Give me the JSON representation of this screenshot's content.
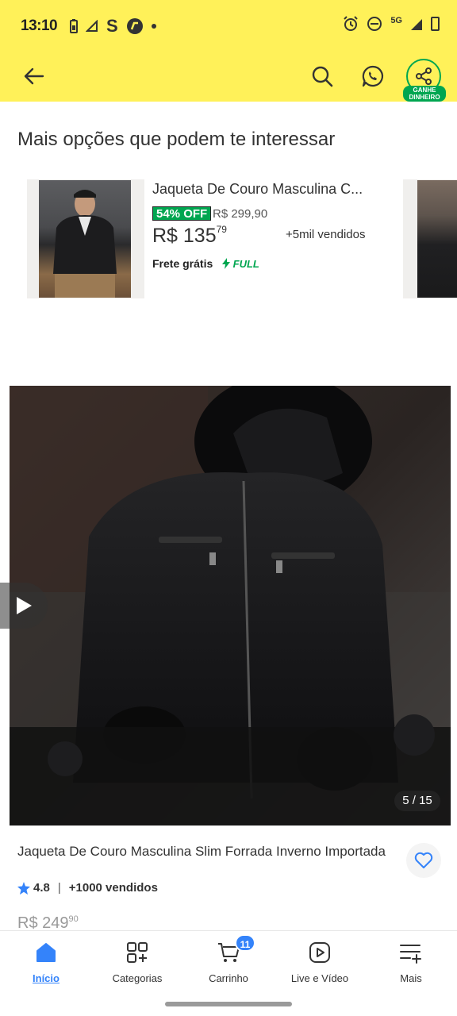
{
  "status_bar": {
    "time": "13:10",
    "left_icons": [
      "battery-saver-icon",
      "signal-a-icon",
      "s-app-icon",
      "hand-app-icon",
      "notification-dot"
    ],
    "right_icons": [
      "alarm-icon",
      "dnd-icon",
      "5g-signal-icon",
      "battery-icon"
    ],
    "network": "5G"
  },
  "app_bar": {
    "background": "#fff159",
    "share_badge_line1": "GANHE",
    "share_badge_line2": "DINHEIRO",
    "accent": "#00a650"
  },
  "recommendations": {
    "title": "Mais opções que podem te interessar",
    "items": [
      {
        "title": "Jaqueta De Couro Masculina C...",
        "discount": "54% OFF",
        "old_price": "R$ 299,90",
        "price_main": "R$ 135",
        "price_cents": "79",
        "sold": "+5mil vendidos",
        "shipping": "Frete grátis",
        "full_label": "FULL"
      }
    ]
  },
  "gallery": {
    "counter": "5 / 15"
  },
  "product": {
    "title": "Jaqueta De Couro Masculina Slim Forrada Inverno Importada",
    "rating": "4.8",
    "separator": "|",
    "sold": "+1000 vendidos",
    "price_main": "R$ 249",
    "price_cents": "90"
  },
  "bottom_nav": {
    "items": [
      {
        "label": "Início",
        "icon": "home-icon",
        "active": true
      },
      {
        "label": "Categorias",
        "icon": "categories-icon",
        "active": false
      },
      {
        "label": "Carrinho",
        "icon": "cart-icon",
        "active": false,
        "badge": "11"
      },
      {
        "label": "Live e Vídeo",
        "icon": "play-icon",
        "active": false
      },
      {
        "label": "Mais",
        "icon": "menu-plus-icon",
        "active": false
      }
    ]
  }
}
